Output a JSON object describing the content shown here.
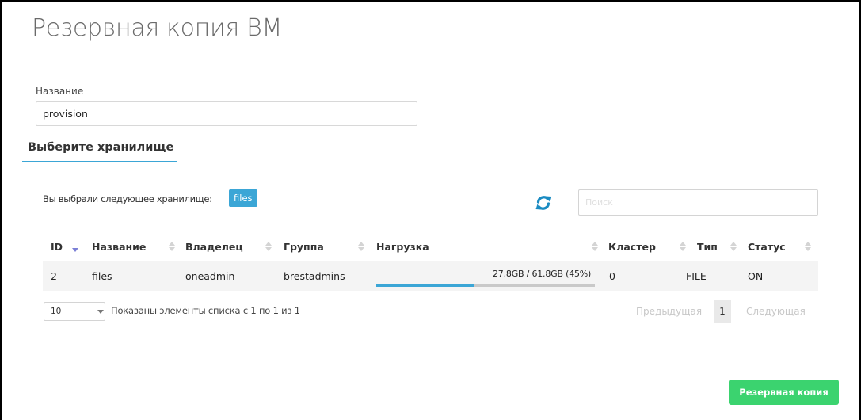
{
  "dialog": {
    "title": "Резервная копия ВМ",
    "name_label": "Название",
    "name_value": "provision",
    "section_title": "Выберите хранилище",
    "selected_text": "Вы выбрали следующее хранилище:",
    "selected_badge": "files",
    "search_placeholder": "Поиск",
    "submit_label": "Резервная копия"
  },
  "table": {
    "columns": [
      "ID",
      "Название",
      "Владелец",
      "Группа",
      "Нагрузка",
      "Кластер",
      "Тип",
      "Статус"
    ],
    "sorted_column": "ID",
    "rows": [
      {
        "id": "2",
        "name": "files",
        "owner": "oneadmin",
        "group": "brestadmins",
        "load_text": "27.8GB / 61.8GB (45%)",
        "load_fraction": 0.45,
        "cluster": "0",
        "type": "FILE",
        "status": "ON"
      }
    ]
  },
  "pagination": {
    "page_size": "10",
    "info": "Показаны элементы списка с 1 по 1 из 1",
    "prev": "Предыдущая",
    "current_page": "1",
    "next": "Следующая"
  },
  "colors": {
    "accent": "#3ba6d6",
    "submit": "#3bd36f",
    "sort_active": "#7b7fd6",
    "refresh": "#1a8bc2"
  }
}
